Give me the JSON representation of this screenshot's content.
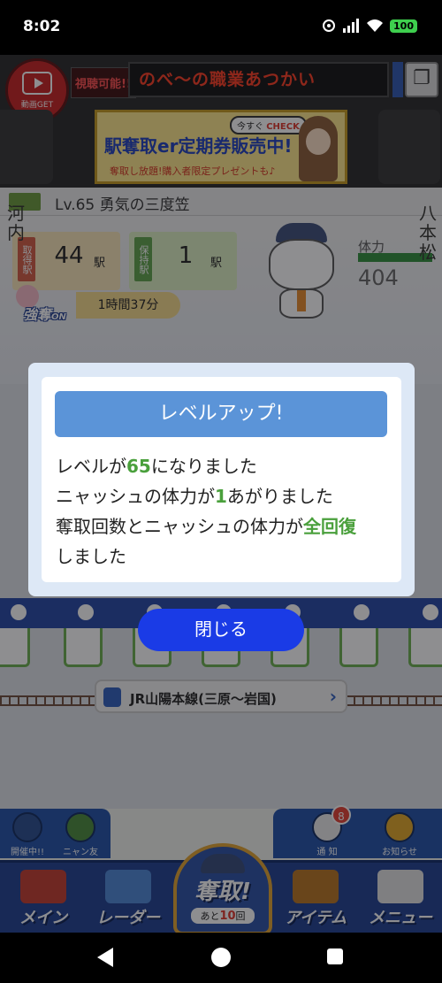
{
  "status": {
    "time": "8:02",
    "battery": "100"
  },
  "top": {
    "video_label": "動画GET",
    "watch_label": "視聴可能!!",
    "ticker_text": "のべ〜の職業あつかい"
  },
  "banner": {
    "main": "駅奪取er定期券販売中!",
    "sub": "奪取し放題!購入者限定プレゼントも♪",
    "check_prefix": "今すぐ",
    "check": "CHECK"
  },
  "level": {
    "text": "Lv.65 勇気の三度笠"
  },
  "stats": {
    "get_tag": "取得駅",
    "get_count": "44",
    "hold_tag": "保持駅",
    "hold_count": "1",
    "unit": "駅",
    "strong_label": "強奪",
    "strong_state": "ON",
    "timer": "1時間37分",
    "hp_label": "体力",
    "hp_value": "404",
    "hp_fraction": 1.0
  },
  "track": {
    "station_left": "河内",
    "station_right": "八本松",
    "line_name": "JR山陽本線(三原〜岩国)"
  },
  "dialog": {
    "title": "レベルアップ!",
    "line1_pre": "レベルが",
    "line1_hl": "65",
    "line1_post": "になりました",
    "line2_pre": "ニャッシュの体力が",
    "line2_hl": "1",
    "line2_post": "あがりました",
    "line3_pre": "奪取回数とニャッシュの体力が",
    "line3_hl": "全回復",
    "line4": "しました",
    "close_label": "閉じる"
  },
  "corner": {
    "event_label": "開催中!!",
    "friends_label": "ニャン友",
    "notice_label": "通 知",
    "notice_badge": "8",
    "news_label": "お知らせ"
  },
  "nav": {
    "main": "メイン",
    "radar": "レーダー",
    "dash": "奪取!",
    "dash_sub_pre": "あと",
    "dash_sub_num": "10",
    "dash_sub_post": "回",
    "item": "アイテム",
    "menu": "メニュー"
  },
  "colors": {
    "accent_blue": "#1a3be6",
    "highlight_green": "#4aa03c",
    "title_blue": "#5b94d8"
  }
}
